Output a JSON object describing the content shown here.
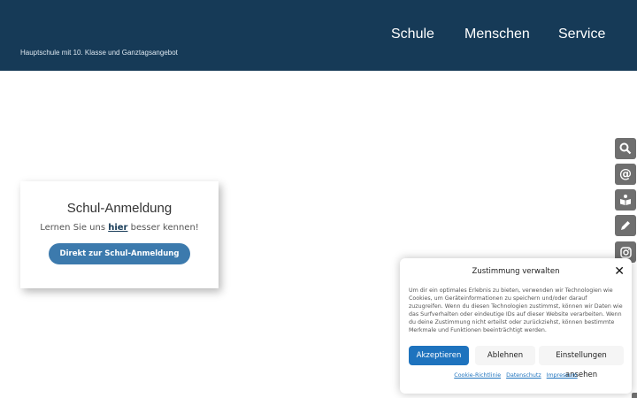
{
  "header": {
    "tagline": "Hauptschule mit 10. Klasse und Ganztagsangebot",
    "nav": [
      "Schule",
      "Menschen",
      "Service"
    ]
  },
  "card": {
    "title": "Schul-Anmeldung",
    "sub_before": "Lernen Sie uns ",
    "sub_link": "hier",
    "sub_after": " besser kennen!",
    "button": "Direkt zur Schul-Anmeldung"
  },
  "side_icons": [
    "search-icon",
    "at-icon",
    "book-icon",
    "pen-icon",
    "instagram-icon"
  ],
  "consent": {
    "title": "Zustimmung verwalten",
    "close": "✕",
    "text": "Um dir ein optimales Erlebnis zu bieten, verwenden wir Technologien wie Cookies, um Geräteinformationen zu speichern und/oder darauf zuzugreifen. Wenn du diesen Technologien zustimmst, können wir Daten wie das Surfverhalten oder eindeutige IDs auf dieser Website verarbeiten. Wenn du deine Zustimmung nicht erteilst oder zurückziehst, können bestimmte Merkmale und Funktionen beeinträchtigt werden.",
    "accept": "Akzeptieren",
    "deny": "Ablehnen",
    "settings": "Einstellungen ansehen",
    "links": [
      "Cookie-Richtlinie",
      "Datenschutz",
      "Impressum"
    ]
  }
}
